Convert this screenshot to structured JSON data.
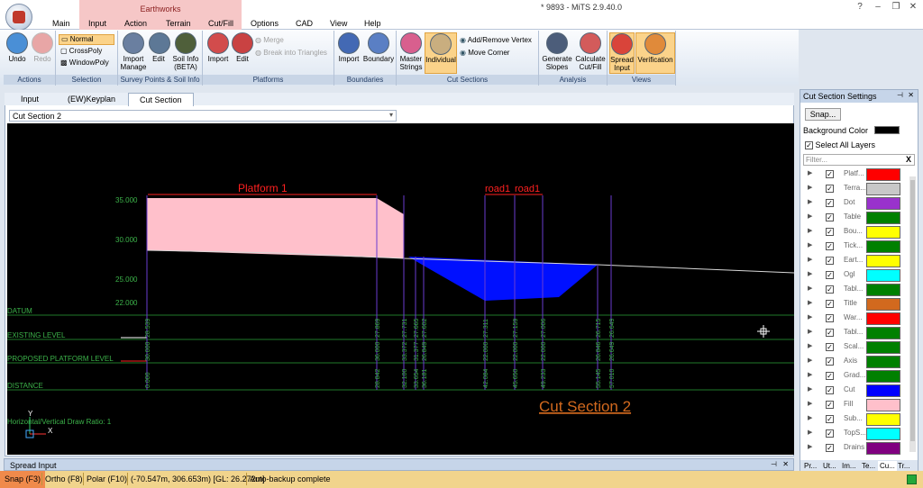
{
  "window": {
    "title": "* 9893 - MiTS 2.9.40.0",
    "help_icon": "?",
    "min_icon": "–",
    "restore_icon": "❐",
    "close_icon": "✕"
  },
  "context_tab": "Earthworks",
  "menu_tabs": [
    "Main",
    "Input",
    "Action",
    "Terrain",
    "Cut/Fill",
    "Options",
    "CAD",
    "View",
    "Help"
  ],
  "ribbon": {
    "actions": {
      "label": "Actions",
      "undo": "Undo",
      "redo": "Redo"
    },
    "selection": {
      "label": "Selection",
      "normal": "Normal",
      "crosspoly": "CrossPoly",
      "windowpoly": "WindowPoly"
    },
    "survey": {
      "label": "Survey Points & Soil Info",
      "import_manage": "Import Manage",
      "edit": "Edit",
      "soil_info": "Soil Info (BETA)"
    },
    "platforms": {
      "label": "Platforms",
      "import": "Import",
      "edit": "Edit",
      "merge": "Merge",
      "break": "Break into Triangles"
    },
    "boundaries": {
      "label": "Boundaries",
      "import": "Import",
      "boundary": "Boundary"
    },
    "cut_sections": {
      "label": "Cut Sections",
      "master": "Master Strings",
      "individual": "Individual",
      "add_remove": "Add/Remove Vertex",
      "move_corner": "Move Corner"
    },
    "analysis": {
      "label": "Analysis",
      "generate": "Generate Slopes",
      "calculate": "Calculate Cut/Fill"
    },
    "views": {
      "label": "Views",
      "spread": "Spread Input",
      "verification": "Verification"
    }
  },
  "doc_tabs": [
    "Input",
    "(EW)Keyplan",
    "Cut Section"
  ],
  "section_dropdown": "Cut Section 2",
  "drawing": {
    "platform_label": "Platform 1",
    "road_labels": [
      "road1",
      "road1"
    ],
    "y_ticks": [
      "35.000",
      "30.000",
      "25.000",
      "22.000"
    ],
    "rows": [
      "DATUM",
      "EXISTING LEVEL",
      "PROPOSED PLATFORM LEVEL",
      "DISTANCE"
    ],
    "ratio_text": "Horizontal/Vertical Draw Ratio: 1",
    "section_title": "Cut Section 2",
    "existing_levels": [
      "28.539",
      "27.869",
      "27.731",
      "27.665",
      "27.602",
      "27.311",
      "27.159",
      "27.006",
      "26.715",
      "26.649"
    ],
    "proposed_levels": [
      "30.000",
      "36.000",
      "33.372",
      "31.377",
      "26.849",
      "22.000",
      "22.000",
      "22.000",
      "26.846",
      "26.649"
    ],
    "distances": [
      "0.000",
      "28.842",
      "32.100",
      "33.654",
      "36.181",
      "42.084",
      "45.650",
      "49.233",
      "55.145",
      "57.010"
    ],
    "axis_y": "Y",
    "axis_x": "X"
  },
  "right_panel": {
    "title": "Cut Section Settings",
    "snap": "Snap...",
    "bg_label": "Background Color",
    "select_all": "Select All Layers",
    "filter_placeholder": "Filter...",
    "layers": [
      {
        "name": "Platf...",
        "color": "#ff0000"
      },
      {
        "name": "Terra...",
        "color": "#c8c8c8"
      },
      {
        "name": "Dot",
        "color": "#9932cc"
      },
      {
        "name": "Table",
        "color": "#008000"
      },
      {
        "name": "Bou...",
        "color": "#ffff00"
      },
      {
        "name": "Tick...",
        "color": "#008000"
      },
      {
        "name": "Eart...",
        "color": "#ffff00"
      },
      {
        "name": "Ogl",
        "color": "#00ffff"
      },
      {
        "name": "Tabl...",
        "color": "#008000"
      },
      {
        "name": "Title",
        "color": "#d2691e"
      },
      {
        "name": "War...",
        "color": "#ff0000"
      },
      {
        "name": "Tabl...",
        "color": "#008000"
      },
      {
        "name": "Scal...",
        "color": "#008000"
      },
      {
        "name": "Axis",
        "color": "#008000"
      },
      {
        "name": "Grad...",
        "color": "#008000"
      },
      {
        "name": "Cut",
        "color": "#0000ff"
      },
      {
        "name": "Fill",
        "color": "#ffc0cb"
      },
      {
        "name": "Sub...",
        "color": "#ffff00"
      },
      {
        "name": "TopS...",
        "color": "#00ffff"
      },
      {
        "name": "Drains",
        "color": "#800080"
      }
    ],
    "bottom_tabs": [
      "Pr...",
      "Ut...",
      "Im...",
      "Te...",
      "Cu...",
      "Tr..."
    ]
  },
  "spread_input": "Spread Input",
  "status": {
    "snap": "Snap (F3)",
    "ortho": "Ortho (F8)",
    "polar": "Polar (F10)",
    "coords": "(-70.547m, 306.653m) [GL: 26.272m]",
    "message": "Auto-backup complete"
  }
}
